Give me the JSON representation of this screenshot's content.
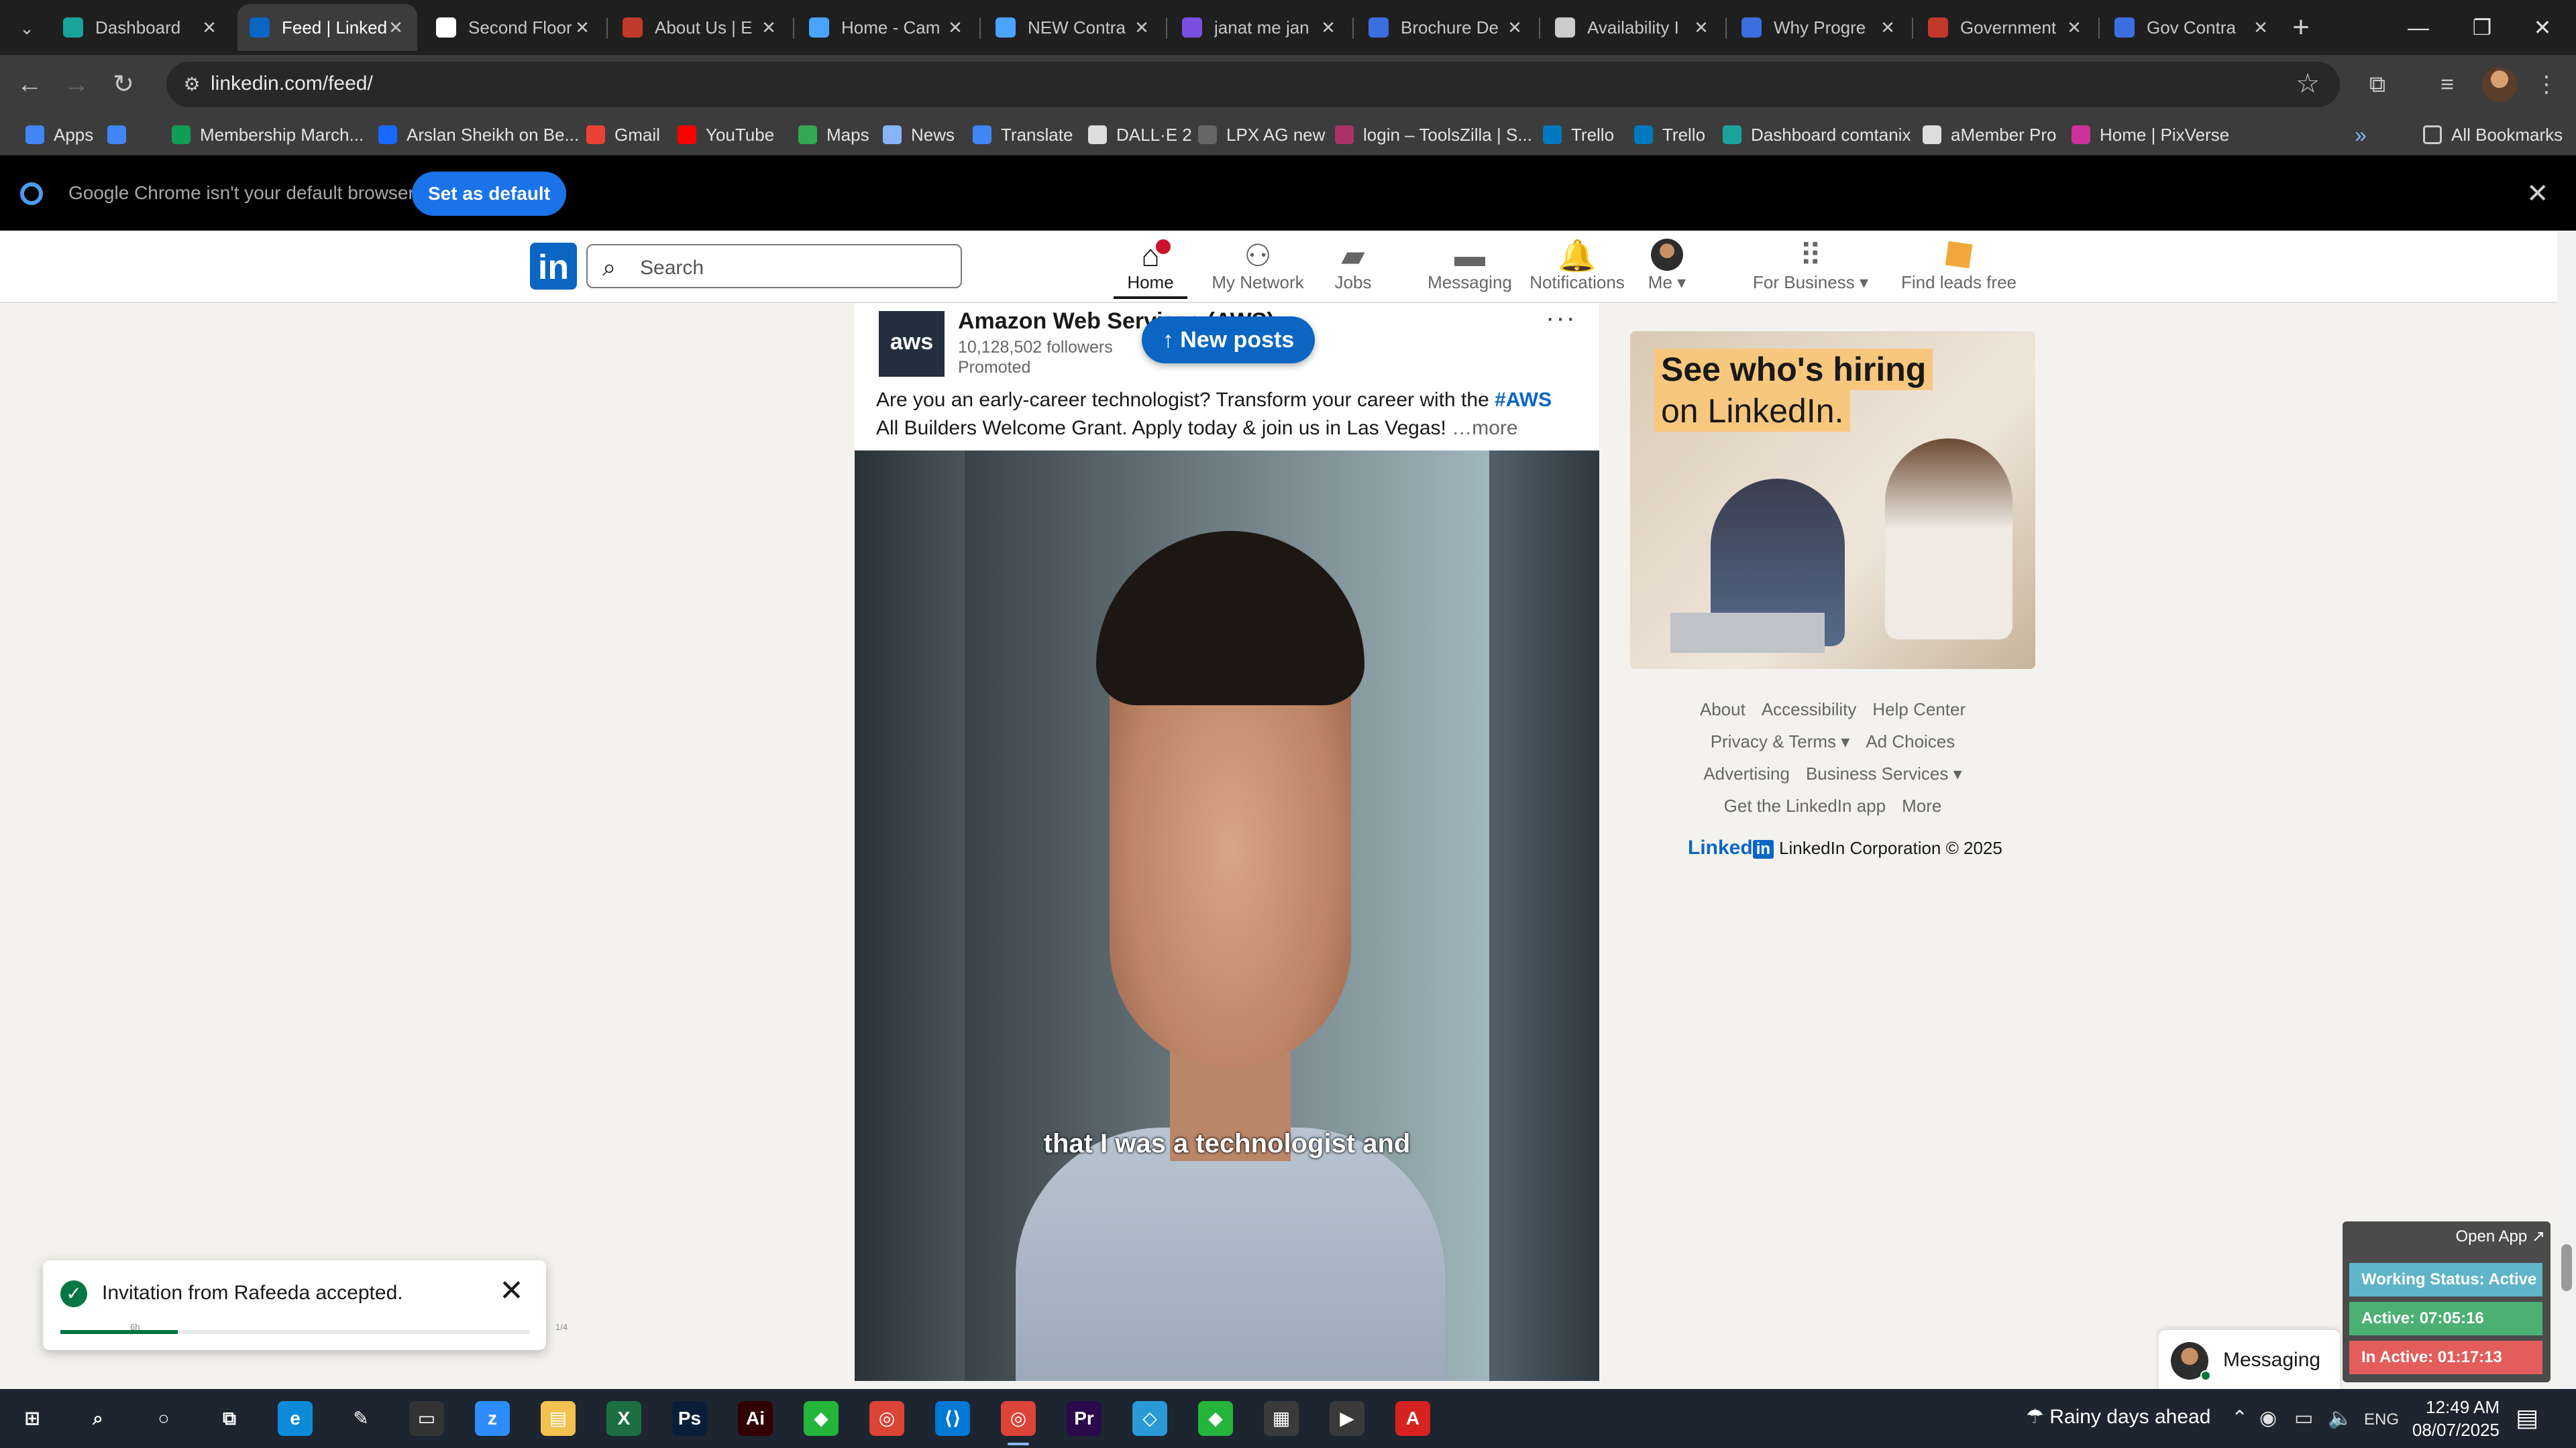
{
  "browser": {
    "tabs": [
      {
        "title": "Dashboard",
        "color": "#1aa39a",
        "active": false
      },
      {
        "title": "Feed | LinkedIn",
        "color": "#0a66c2",
        "active": true
      },
      {
        "title": "Second Floor",
        "color": "#ffffff",
        "active": false
      },
      {
        "title": "About Us | E",
        "color": "#c0392b",
        "active": false
      },
      {
        "title": "Home - Cam",
        "color": "#4aa3ff",
        "active": false
      },
      {
        "title": "NEW Contra",
        "color": "#4aa3ff",
        "active": false
      },
      {
        "title": "janat me jan",
        "color": "#7b4fe0",
        "active": false
      },
      {
        "title": "Brochure De",
        "color": "#3b6fe0",
        "active": false
      },
      {
        "title": "Availability I",
        "color": "#cccccc",
        "active": false
      },
      {
        "title": "Why Progre",
        "color": "#3b6fe0",
        "active": false
      },
      {
        "title": "Government",
        "color": "#c0392b",
        "active": false
      },
      {
        "title": "Gov Contra",
        "color": "#3b6fe0",
        "active": false
      }
    ],
    "window_controls": {
      "minimize": "—",
      "restore": "❐",
      "close": "✕"
    },
    "url": "linkedin.com/feed/",
    "bookmarks": [
      {
        "label": "Apps",
        "color": "#4285f4"
      },
      {
        "label": "",
        "color": "#4285f4"
      },
      {
        "label": "Membership March...",
        "color": "#0f9d58"
      },
      {
        "label": "Arslan Sheikh on Be...",
        "color": "#1769ff"
      },
      {
        "label": "Gmail",
        "color": "#ea4335"
      },
      {
        "label": "YouTube",
        "color": "#ff0000"
      },
      {
        "label": "Maps",
        "color": "#34a853"
      },
      {
        "label": "News",
        "color": "#8ab4f8"
      },
      {
        "label": "Translate",
        "color": "#4285f4"
      },
      {
        "label": "DALL·E 2",
        "color": "#dddddd"
      },
      {
        "label": "LPX AG new",
        "color": "#666666"
      },
      {
        "label": "login – ToolsZilla | S...",
        "color": "#aa3366"
      },
      {
        "label": "Trello",
        "color": "#0079bf"
      },
      {
        "label": "Trello",
        "color": "#0079bf"
      },
      {
        "label": "Dashboard comtanix",
        "color": "#1aa39a"
      },
      {
        "label": "aMember Pro",
        "color": "#dddddd"
      },
      {
        "label": "Home | PixVerse",
        "color": "#cc3399"
      }
    ],
    "all_bookmarks": "All Bookmarks",
    "infobar": {
      "message": "Google Chrome isn't your default browser",
      "button": "Set as default"
    }
  },
  "linkedin": {
    "search_placeholder": "Search",
    "nav": [
      {
        "label": "Home",
        "icon": "home-icon",
        "active": true
      },
      {
        "label": "My Network",
        "icon": "network-icon",
        "active": false
      },
      {
        "label": "Jobs",
        "icon": "briefcase-icon",
        "active": false
      },
      {
        "label": "Messaging",
        "icon": "chat-icon",
        "active": false
      },
      {
        "label": "Notifications",
        "icon": "bell-icon",
        "active": false
      },
      {
        "label": "Me ▾",
        "icon": "avatar",
        "active": false
      },
      {
        "label": "For Business ▾",
        "icon": "grid-icon",
        "active": false
      },
      {
        "label": "Find leads free",
        "icon": "leads-icon",
        "active": false
      }
    ],
    "post": {
      "author": "Amazon Web Services (AWS)",
      "logo_text": "aws",
      "followers": "10,128,502 followers",
      "promoted": "Promoted",
      "text_before": "Are you an early-career technologist? Transform your career with the ",
      "hashtag": "#AWS",
      "text_after": " All Builders Welcome Grant. Apply today & join us in Las Vegas!",
      "more": " …more",
      "caption": "that I was a technologist and"
    },
    "new_posts": "↑ New posts",
    "ad": {
      "line1": "See who's hiring",
      "line2": "on LinkedIn."
    },
    "footer": {
      "row1": [
        "About",
        "Accessibility",
        "Help Center"
      ],
      "row2": [
        "Privacy & Terms ▾",
        "Ad Choices"
      ],
      "row3": [
        "Advertising",
        "Business Services ▾"
      ],
      "row4": [
        "Get the LinkedIn app",
        "More"
      ],
      "copyright_brand": "Linked",
      "copyright_brand_box": "in",
      "copyright": "LinkedIn Corporation © 2025"
    },
    "toast": {
      "message": "Invitation from Rafeeda accepted.",
      "progress": 0.25,
      "left_tiny": "6h",
      "right_tiny": "1/4"
    },
    "messaging": "Messaging"
  },
  "tracker": {
    "open_app": "Open App ↗",
    "working_status": "Working Status: Active",
    "active": "Active: 07:05:16",
    "inactive": "In Active: 01:17:13"
  },
  "taskbar": {
    "apps": [
      {
        "name": "start",
        "glyph": "⊞",
        "color": "#1c2530"
      },
      {
        "name": "search",
        "glyph": "⌕",
        "color": "#1c2530"
      },
      {
        "name": "cortana",
        "glyph": "○",
        "color": "#1c2530"
      },
      {
        "name": "task-view",
        "glyph": "⧉",
        "color": "#1c2530"
      },
      {
        "name": "edge",
        "glyph": "e",
        "color": "#0c8ad8"
      },
      {
        "name": "pen",
        "glyph": "✎",
        "color": "#1c2530"
      },
      {
        "name": "terminal",
        "glyph": "▭",
        "color": "#333333"
      },
      {
        "name": "zoom",
        "glyph": "z",
        "color": "#2d8cff"
      },
      {
        "name": "explorer",
        "glyph": "▤",
        "color": "#f2c14e"
      },
      {
        "name": "excel",
        "glyph": "X",
        "color": "#1d6f42"
      },
      {
        "name": "photoshop",
        "glyph": "Ps",
        "color": "#0a1e3c"
      },
      {
        "name": "illustrator",
        "glyph": "Ai",
        "color": "#330000"
      },
      {
        "name": "tool-green",
        "glyph": "◆",
        "color": "#24b53a"
      },
      {
        "name": "chrome",
        "glyph": "◎",
        "color": "#db4437"
      },
      {
        "name": "vscode",
        "glyph": "⟨⟩",
        "color": "#0078d4"
      },
      {
        "name": "chrome-running",
        "glyph": "◎",
        "color": "#db4437"
      },
      {
        "name": "premiere",
        "glyph": "Pr",
        "color": "#2a0a4a"
      },
      {
        "name": "app-diamond",
        "glyph": "◇",
        "color": "#2a9ad6"
      },
      {
        "name": "app-green",
        "glyph": "◆",
        "color": "#24b53a"
      },
      {
        "name": "calculator",
        "glyph": "▦",
        "color": "#3a3a3a"
      },
      {
        "name": "media-player",
        "glyph": "▶",
        "color": "#3a3a3a"
      },
      {
        "name": "acrobat",
        "glyph": "A",
        "color": "#d6231f"
      }
    ],
    "weather": "Rainy days ahead",
    "language": "ENG",
    "time": "12:49 AM",
    "date": "08/07/2025"
  }
}
